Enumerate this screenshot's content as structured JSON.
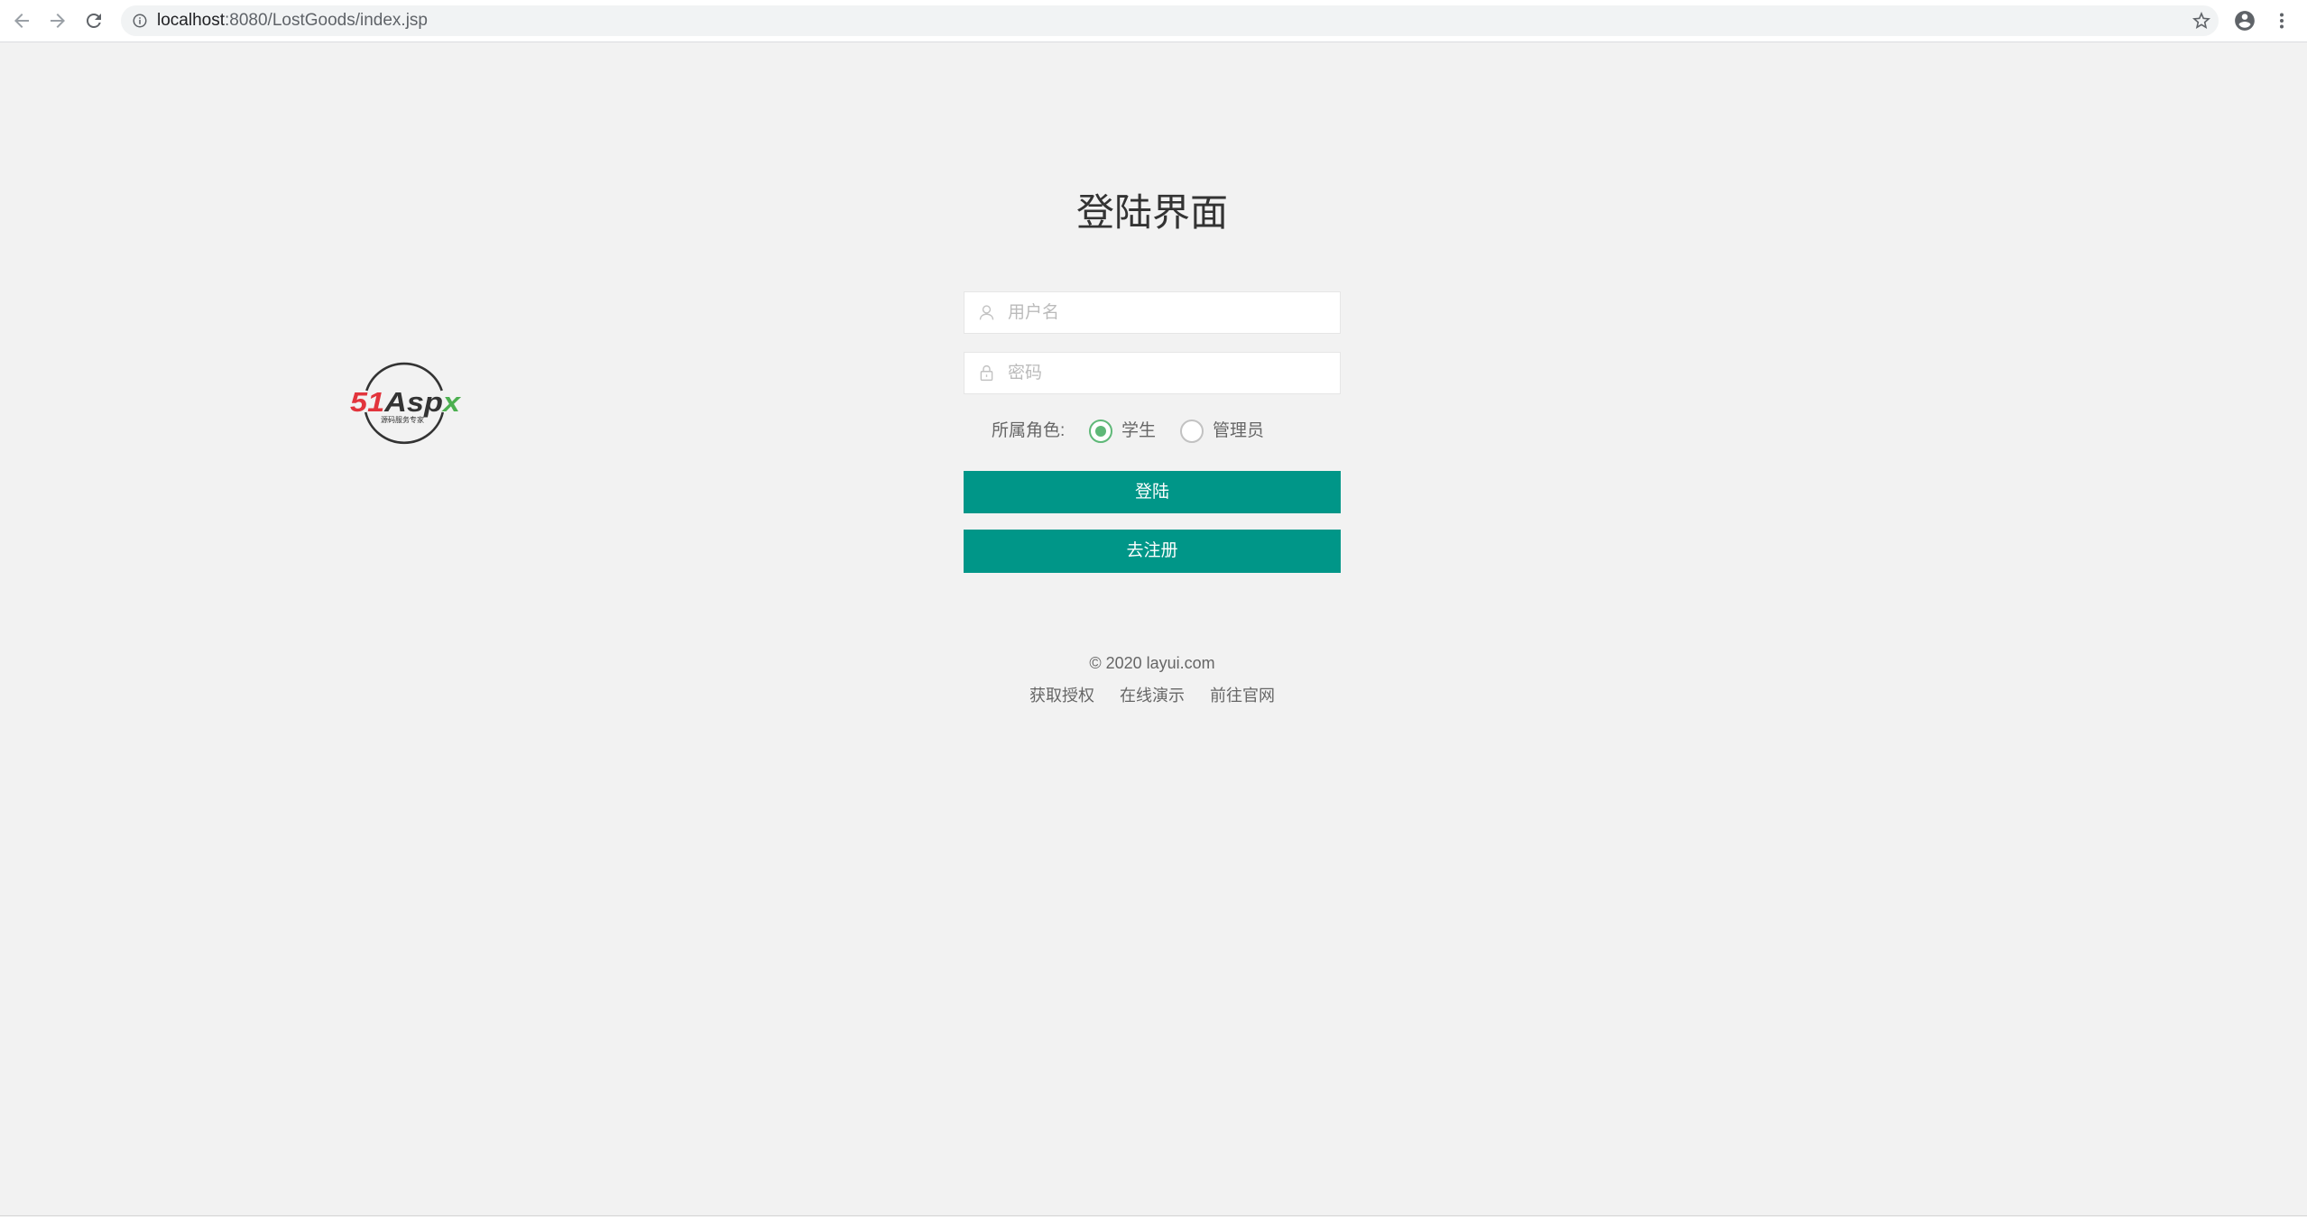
{
  "browser": {
    "url": {
      "host": "localhost",
      "path": ":8080/LostGoods/index.jsp"
    },
    "icons": {
      "back": "back-arrow-icon",
      "forward": "forward-arrow-icon",
      "reload": "reload-icon",
      "info": "info-icon",
      "bookmark": "star-icon",
      "account": "account-circle-icon",
      "menu": "more-vert-icon"
    }
  },
  "logo": {
    "brand_number": "51",
    "brand_asp": "Asp",
    "brand_x": "x",
    "tagline": "源码服务专家"
  },
  "login": {
    "title": "登陆界面",
    "username_placeholder": "用户名",
    "password_placeholder": "密码",
    "role_label": "所属角色:",
    "roles": [
      {
        "label": "学生",
        "selected": true
      },
      {
        "label": "管理员",
        "selected": false
      }
    ],
    "login_button": "登陆",
    "register_button": "去注册",
    "icons": {
      "username": "user-icon",
      "password": "lock-icon"
    }
  },
  "footer": {
    "copyright": "© 2020 layui.com",
    "links": [
      "获取授权",
      "在线演示",
      "前往官网"
    ]
  },
  "colors": {
    "page_bg": "#f2f2f2",
    "accent": "#009688",
    "radio_checked": "#5fb878",
    "logo_red": "#e2343c",
    "logo_green": "#4caf50"
  }
}
